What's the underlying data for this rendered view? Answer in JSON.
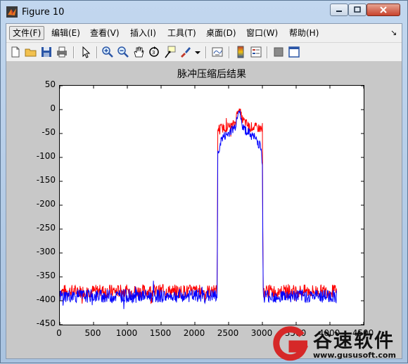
{
  "window": {
    "title": "Figure 10"
  },
  "menu": {
    "items": [
      {
        "label": "文件(F)"
      },
      {
        "label": "编辑(E)"
      },
      {
        "label": "查看(V)"
      },
      {
        "label": "插入(I)"
      },
      {
        "label": "工具(T)"
      },
      {
        "label": "桌面(D)"
      },
      {
        "label": "窗口(W)"
      },
      {
        "label": "帮助(H)"
      }
    ],
    "dock_arrow": "↘"
  },
  "toolbar": {
    "icons": [
      "new-figure-icon",
      "open-file-icon",
      "save-icon",
      "print-icon",
      "select-arrow-icon",
      "zoom-in-icon",
      "zoom-out-icon",
      "pan-hand-icon",
      "rotate-3d-icon",
      "data-cursor-icon",
      "brush-icon",
      "link-plot-icon",
      "colorbar-icon",
      "legend-icon",
      "hide-plot-tools-icon",
      "show-plot-tools-icon"
    ]
  },
  "chart_data": {
    "type": "line",
    "title": "脉冲压缩后结果",
    "xlabel": "",
    "ylabel": "",
    "xlim": [
      0,
      4500
    ],
    "ylim": [
      -450,
      50
    ],
    "xticks": [
      "0",
      "500",
      "1000",
      "1500",
      "2000",
      "2500",
      "3000",
      "3500",
      "4000",
      "4500"
    ],
    "yticks": [
      "50",
      "0",
      "-50",
      "-100",
      "-150",
      "-200",
      "-250",
      "-300",
      "-350",
      "-400",
      "-450"
    ],
    "grid": false,
    "series": [
      {
        "color": "#ff0000",
        "description_points": [
          [
            0,
            -380
          ],
          [
            2330,
            -380
          ],
          [
            2340,
            -40
          ],
          [
            2550,
            -35
          ],
          [
            2600,
            -25
          ],
          [
            2650,
            5
          ],
          [
            2700,
            -20
          ],
          [
            2800,
            -35
          ],
          [
            3000,
            -40
          ],
          [
            3010,
            -380
          ],
          [
            4100,
            -380
          ]
        ]
      },
      {
        "color": "#0000ff",
        "description_points": [
          [
            0,
            -390
          ],
          [
            2330,
            -390
          ],
          [
            2340,
            -100
          ],
          [
            2360,
            -80
          ],
          [
            2400,
            -60
          ],
          [
            2500,
            -50
          ],
          [
            2600,
            -35
          ],
          [
            2650,
            5
          ],
          [
            2700,
            -35
          ],
          [
            2800,
            -50
          ],
          [
            2900,
            -60
          ],
          [
            2980,
            -80
          ],
          [
            3000,
            -110
          ],
          [
            3010,
            -390
          ],
          [
            4100,
            -390
          ]
        ]
      }
    ]
  },
  "watermark": {
    "name": "谷速软件",
    "url": "www.gususoft.com"
  },
  "colors": {
    "series1": "#ff0000",
    "series2": "#0000ff",
    "figure_bg": "#c8c8c8"
  }
}
